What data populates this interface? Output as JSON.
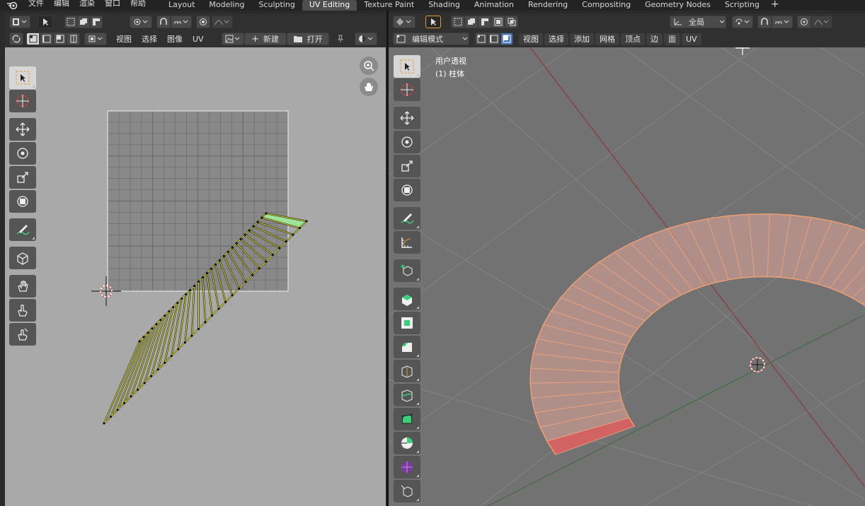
{
  "topbar": {
    "menus": [
      "文件",
      "编辑",
      "渲染",
      "窗口",
      "帮助"
    ],
    "workspaces": [
      "Layout",
      "Modeling",
      "Sculpting",
      "UV Editing",
      "Texture Paint",
      "Shading",
      "Animation",
      "Rendering",
      "Compositing",
      "Geometry Nodes",
      "Scripting"
    ],
    "active_workspace": "UV Editing",
    "add_label": "+"
  },
  "uv_editor": {
    "menus": [
      "视图",
      "选择",
      "图像",
      "UV"
    ],
    "new_label": "新建",
    "open_label": "打开",
    "grid_color": "#7b7b7b",
    "uv_color": "#e7e733"
  },
  "viewport": {
    "mode_label": "编辑模式",
    "menus": [
      "视图",
      "选择",
      "添加",
      "网格",
      "顶点",
      "边",
      "面",
      "UV"
    ],
    "transform_orientation": "全局",
    "overlay_title": "用户透视",
    "overlay_object": "(1) 柱体",
    "mesh_color": "#e8a07a",
    "selected_face_color": "#e26060"
  },
  "colors": {
    "header": "#303030",
    "selected_button": "#4772b3",
    "accent_orange": "#f0a030"
  }
}
